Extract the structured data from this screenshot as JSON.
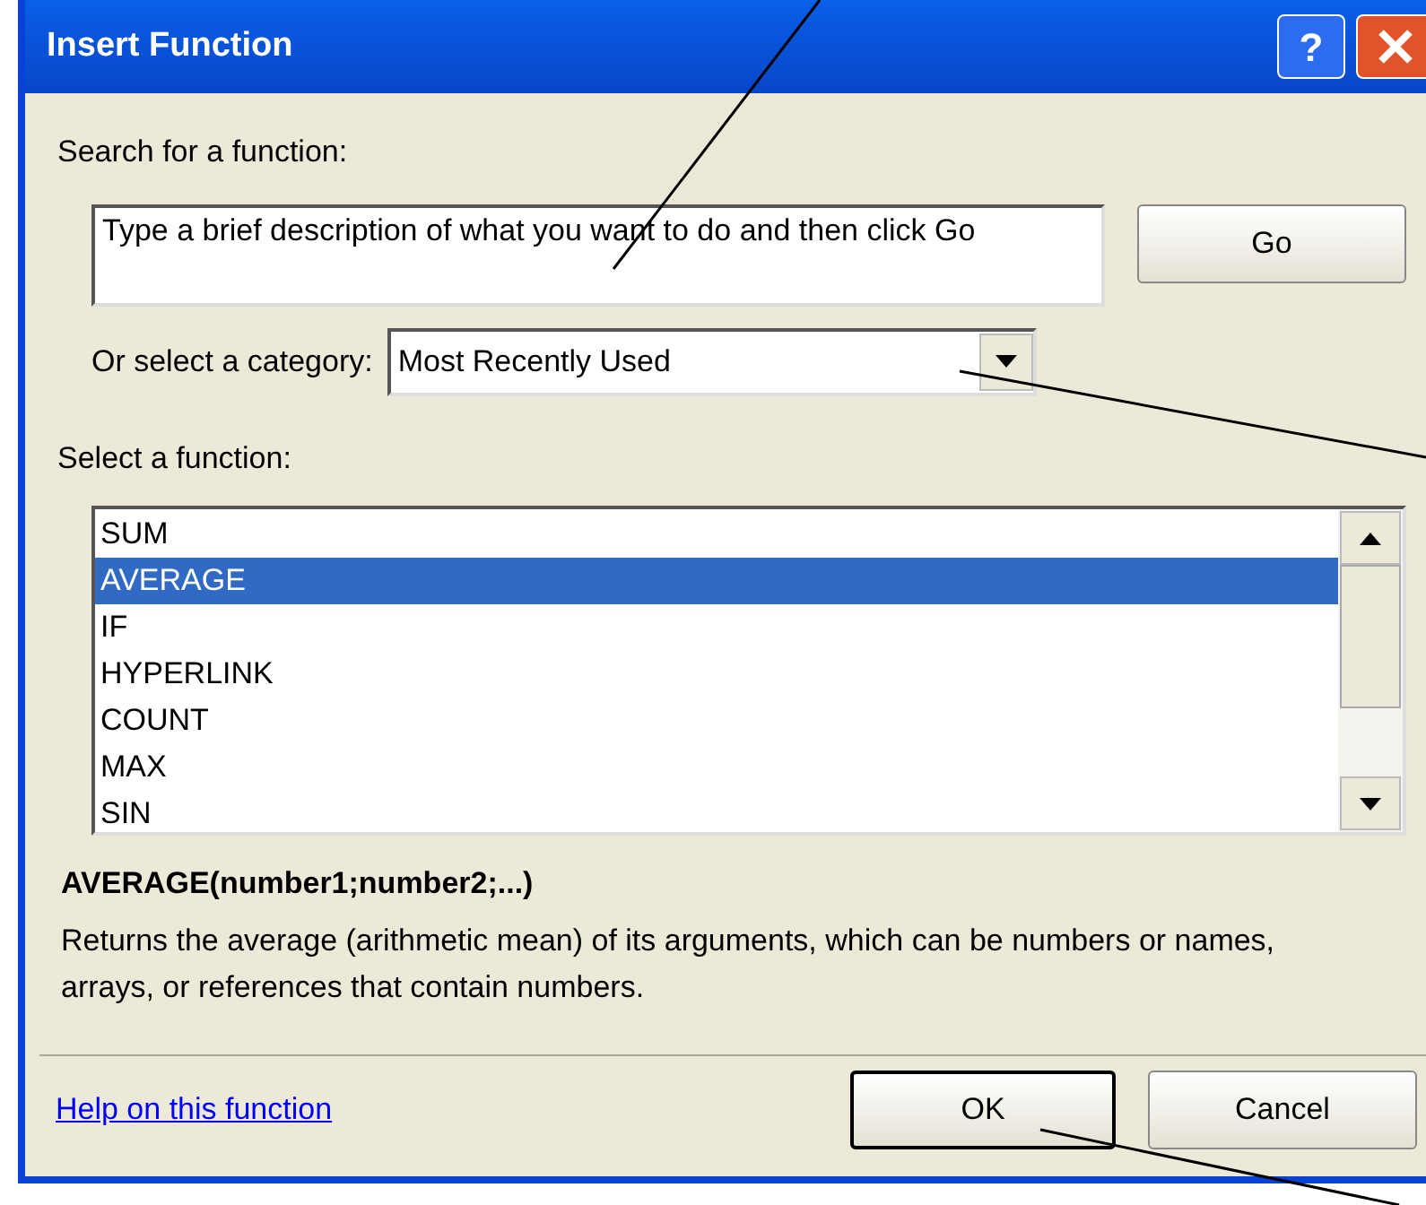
{
  "window": {
    "title": "Insert Function",
    "buttons": [
      "?"
    ]
  },
  "search": {
    "label": "Search for a function:",
    "value": "Type a brief description of what you want to do and then click Go",
    "button": "Go"
  },
  "category": {
    "label": "Or select a category:",
    "value": "Most Recently Used"
  },
  "functions": {
    "label": "Select a function:",
    "items": [
      {
        "name": "SUM",
        "selected": false
      },
      {
        "name": "AVERAGE",
        "selected": true
      },
      {
        "name": "IF",
        "selected": false
      },
      {
        "name": "HYPERLINK",
        "selected": false
      },
      {
        "name": "COUNT",
        "selected": false
      },
      {
        "name": "MAX",
        "selected": false
      },
      {
        "name": "SIN",
        "selected": false
      }
    ]
  },
  "signature": "AVERAGE(number1;number2;...)",
  "description": "Returns the average (arithmetic mean) of its arguments, which can be numbers or names, arrays, or references that contain numbers.",
  "help_link": "Help on this function",
  "buttons": [
    {
      "label": "OK",
      "default": true
    },
    {
      "label": "Cancel",
      "default": false
    }
  ]
}
